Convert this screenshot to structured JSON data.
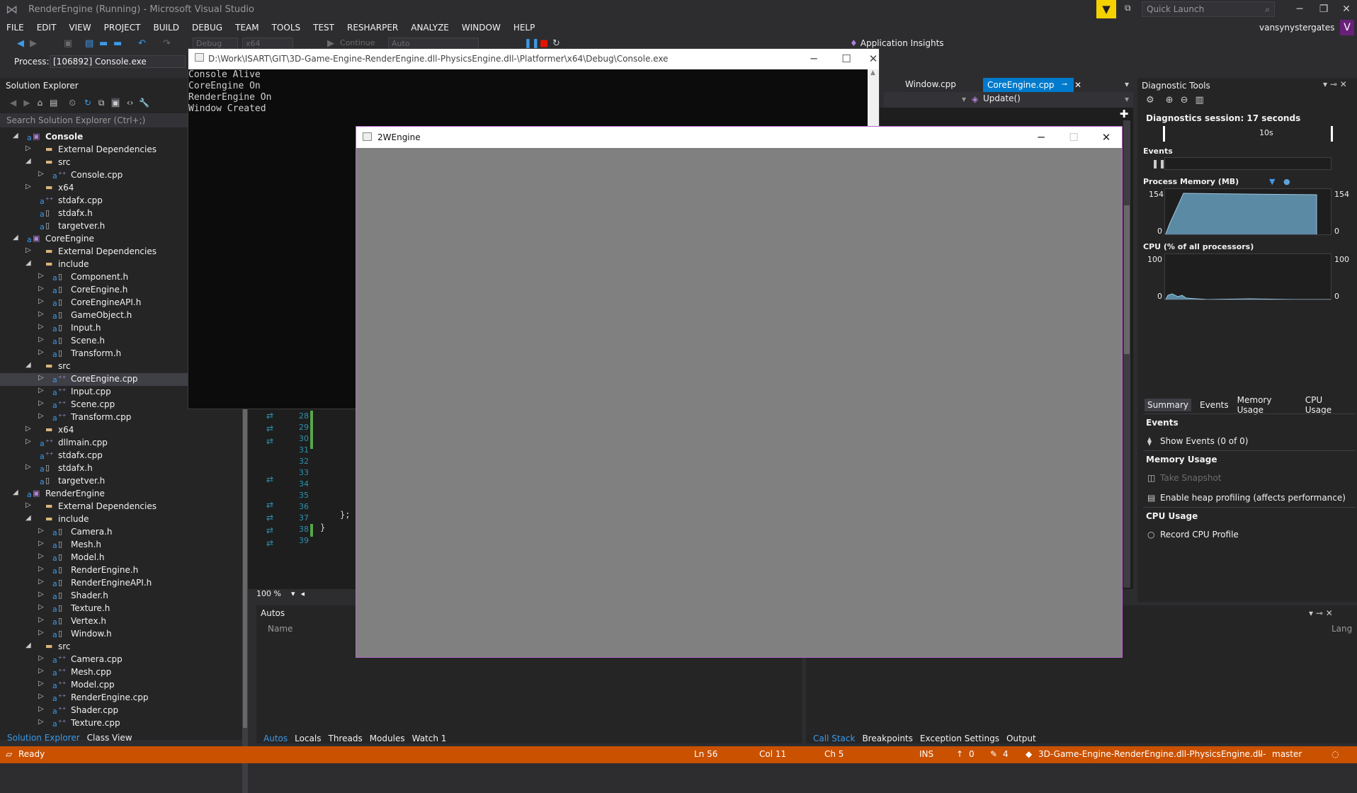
{
  "window": {
    "title": "RenderEngine (Running) - Microsoft Visual Studio",
    "quick_launch": "Quick Launch",
    "user": "vansynystergates",
    "avatar": "V"
  },
  "menu": [
    "FILE",
    "EDIT",
    "VIEW",
    "PROJECT",
    "BUILD",
    "DEBUG",
    "TEAM",
    "TOOLS",
    "TEST",
    "RESHARPER",
    "ANALYZE",
    "WINDOW",
    "HELP"
  ],
  "toolbar": {
    "config": "Debug",
    "platform": "x64",
    "continue": "Continue",
    "auto": "Auto",
    "app_insights": "Application Insights"
  },
  "process": {
    "label": "Process:",
    "value": "[106892] Console.exe"
  },
  "solution_explorer": {
    "title": "Solution Explorer",
    "search": "Search Solution Explorer (Ctrl+;)",
    "items": [
      {
        "d": 0,
        "t": "Console",
        "k": "proj",
        "e": "open",
        "b": true
      },
      {
        "d": 1,
        "t": "External Dependencies",
        "k": "fold",
        "e": "closed"
      },
      {
        "d": 1,
        "t": "src",
        "k": "fold",
        "e": "open"
      },
      {
        "d": 2,
        "t": "Console.cpp",
        "k": "cpp",
        "e": "closed"
      },
      {
        "d": 1,
        "t": "x64",
        "k": "fold",
        "e": "closed"
      },
      {
        "d": 1,
        "t": "stdafx.cpp",
        "k": "cpp",
        "e": "none"
      },
      {
        "d": 1,
        "t": "stdafx.h",
        "k": "hf",
        "e": "none"
      },
      {
        "d": 1,
        "t": "targetver.h",
        "k": "hf",
        "e": "none"
      },
      {
        "d": 0,
        "t": "CoreEngine",
        "k": "proj",
        "e": "open"
      },
      {
        "d": 1,
        "t": "External Dependencies",
        "k": "fold",
        "e": "closed"
      },
      {
        "d": 1,
        "t": "include",
        "k": "fold",
        "e": "open"
      },
      {
        "d": 2,
        "t": "Component.h",
        "k": "hf",
        "e": "closed"
      },
      {
        "d": 2,
        "t": "CoreEngine.h",
        "k": "hf",
        "e": "closed"
      },
      {
        "d": 2,
        "t": "CoreEngineAPI.h",
        "k": "hf",
        "e": "closed"
      },
      {
        "d": 2,
        "t": "GameObject.h",
        "k": "hf",
        "e": "closed"
      },
      {
        "d": 2,
        "t": "Input.h",
        "k": "hf",
        "e": "closed"
      },
      {
        "d": 2,
        "t": "Scene.h",
        "k": "hf",
        "e": "closed"
      },
      {
        "d": 2,
        "t": "Transform.h",
        "k": "hf",
        "e": "closed"
      },
      {
        "d": 1,
        "t": "src",
        "k": "fold",
        "e": "open"
      },
      {
        "d": 2,
        "t": "CoreEngine.cpp",
        "k": "cpp",
        "e": "closed",
        "sel": true
      },
      {
        "d": 2,
        "t": "Input.cpp",
        "k": "cpp",
        "e": "closed"
      },
      {
        "d": 2,
        "t": "Scene.cpp",
        "k": "cpp",
        "e": "closed"
      },
      {
        "d": 2,
        "t": "Transform.cpp",
        "k": "cpp",
        "e": "closed"
      },
      {
        "d": 1,
        "t": "x64",
        "k": "fold",
        "e": "closed"
      },
      {
        "d": 1,
        "t": "dllmain.cpp",
        "k": "cpp",
        "e": "closed"
      },
      {
        "d": 1,
        "t": "stdafx.cpp",
        "k": "cpp",
        "e": "none"
      },
      {
        "d": 1,
        "t": "stdafx.h",
        "k": "hf",
        "e": "closed"
      },
      {
        "d": 1,
        "t": "targetver.h",
        "k": "hf",
        "e": "none"
      },
      {
        "d": 0,
        "t": "RenderEngine",
        "k": "proj",
        "e": "open"
      },
      {
        "d": 1,
        "t": "External Dependencies",
        "k": "fold",
        "e": "closed"
      },
      {
        "d": 1,
        "t": "include",
        "k": "fold",
        "e": "open"
      },
      {
        "d": 2,
        "t": "Camera.h",
        "k": "hf",
        "e": "closed"
      },
      {
        "d": 2,
        "t": "Mesh.h",
        "k": "hf",
        "e": "closed"
      },
      {
        "d": 2,
        "t": "Model.h",
        "k": "hf",
        "e": "closed"
      },
      {
        "d": 2,
        "t": "RenderEngine.h",
        "k": "hf",
        "e": "closed"
      },
      {
        "d": 2,
        "t": "RenderEngineAPI.h",
        "k": "hf",
        "e": "closed"
      },
      {
        "d": 2,
        "t": "Shader.h",
        "k": "hf",
        "e": "closed"
      },
      {
        "d": 2,
        "t": "Texture.h",
        "k": "hf",
        "e": "closed"
      },
      {
        "d": 2,
        "t": "Vertex.h",
        "k": "hf",
        "e": "closed"
      },
      {
        "d": 2,
        "t": "Window.h",
        "k": "hf",
        "e": "closed"
      },
      {
        "d": 1,
        "t": "src",
        "k": "fold",
        "e": "open"
      },
      {
        "d": 2,
        "t": "Camera.cpp",
        "k": "cpp",
        "e": "closed"
      },
      {
        "d": 2,
        "t": "Mesh.cpp",
        "k": "cpp",
        "e": "closed"
      },
      {
        "d": 2,
        "t": "Model.cpp",
        "k": "cpp",
        "e": "closed"
      },
      {
        "d": 2,
        "t": "RenderEngine.cpp",
        "k": "cpp",
        "e": "closed"
      },
      {
        "d": 2,
        "t": "Shader.cpp",
        "k": "cpp",
        "e": "closed"
      },
      {
        "d": 2,
        "t": "Texture.cpp",
        "k": "cpp",
        "e": "closed"
      }
    ],
    "tabs": [
      "Solution Explorer",
      "Class View"
    ]
  },
  "editor": {
    "tab1": "Window.cpp",
    "tab2": "CoreEngine.cpp",
    "member": "Update()",
    "zoom": "100 %",
    "line_numbers": [
      "28",
      "29",
      "30",
      "31",
      "32",
      "33",
      "34",
      "35",
      "36",
      "37",
      "38",
      "39"
    ],
    "code": [
      "};",
      "}"
    ]
  },
  "console": {
    "title": "D:\\Work\\ISART\\GIT\\3D-Game-Engine-RenderEngine.dll-PhysicsEngine.dll-\\Platformer\\x64\\Debug\\Console.exe",
    "lines": [
      "Console Alive",
      "CoreEngine On",
      "RenderEngine On",
      "Window Created"
    ]
  },
  "engine_window": {
    "title": "2WEngine"
  },
  "diagnostics": {
    "title": "Diagnostic Tools",
    "session": "Diagnostics session: 17 seconds",
    "timeline_label": "10s",
    "events": "Events",
    "memory": "Process Memory (MB)",
    "mem_max": "154",
    "mem_min": "0",
    "cpu": "CPU (% of all processors)",
    "cpu_max": "100",
    "cpu_min": "0",
    "tabs": [
      "Summary",
      "Events",
      "Memory Usage",
      "CPU Usage"
    ],
    "events_h": "Events",
    "show_events": "Show Events (0 of 0)",
    "memory_h": "Memory Usage",
    "snapshot": "Take Snapshot",
    "heap": "Enable heap profiling (affects performance)",
    "cpu_h": "CPU Usage",
    "record": "Record CPU Profile"
  },
  "autos": {
    "title": "Autos",
    "col": "Name",
    "tabs": [
      "Autos",
      "Locals",
      "Threads",
      "Modules",
      "Watch 1"
    ],
    "lang_col": "Lang"
  },
  "callstack": {
    "tabs": [
      "Call Stack",
      "Breakpoints",
      "Exception Settings",
      "Output"
    ]
  },
  "status": {
    "ready": "Ready",
    "ln": "Ln 56",
    "col": "Col 11",
    "ch": "Ch 5",
    "ins": "INS",
    "up": "0",
    "pencil": "4",
    "repo": "3D-Game-Engine-RenderEngine.dll-PhysicsEngine.dll-",
    "branch": "master"
  }
}
